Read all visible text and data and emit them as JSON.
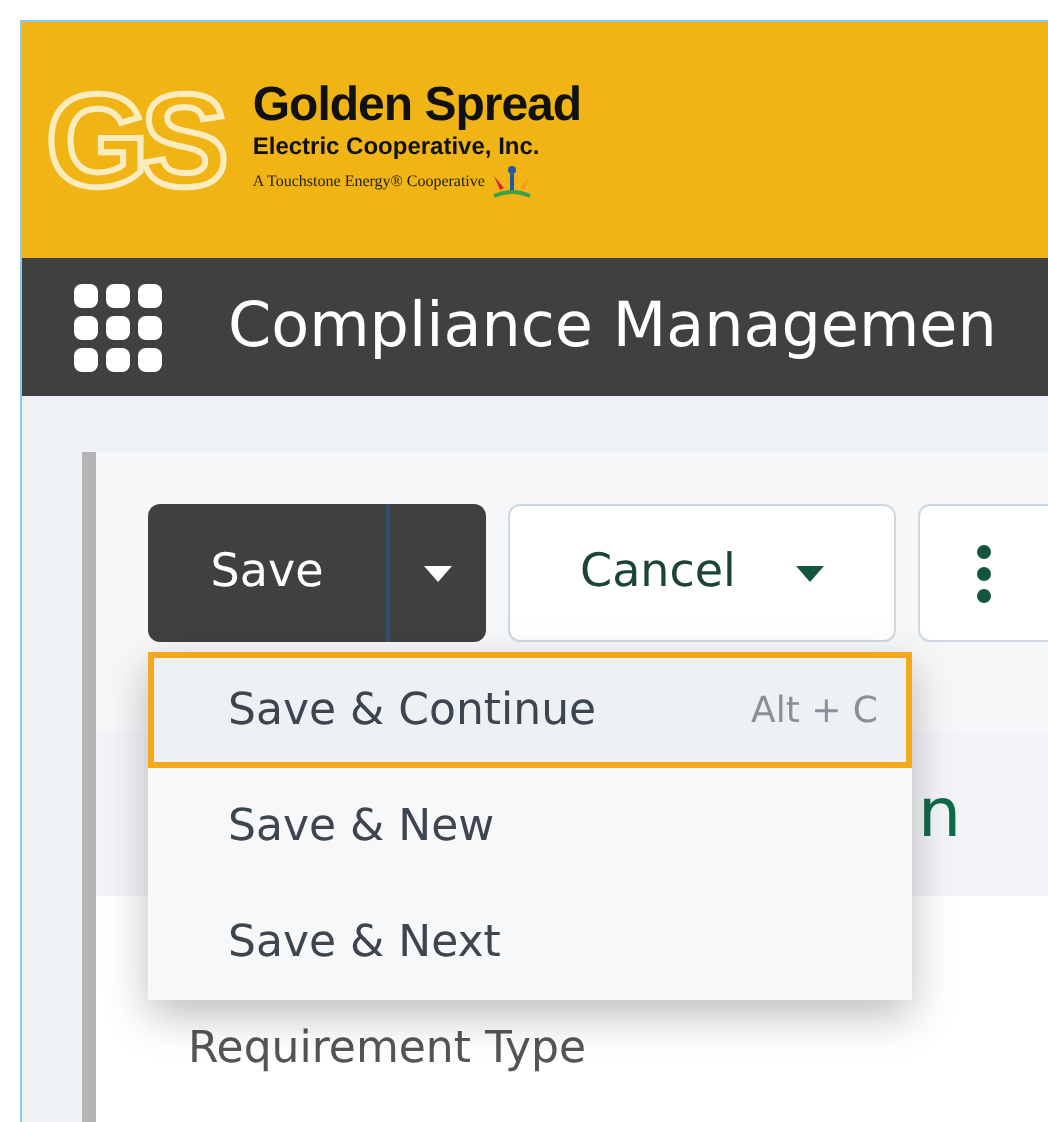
{
  "header": {
    "logo_mark": "GS",
    "company_name": "Golden Spread",
    "company_subtitle": "Electric Cooperative, Inc.",
    "tagline": "A Touchstone Energy® Cooperative"
  },
  "nav": {
    "title": "Compliance Managemen"
  },
  "toolbar": {
    "save_button": "Save",
    "cancel_button": "Cancel"
  },
  "save_menu": [
    {
      "label": "Save & Continue",
      "shortcut": "Alt + C",
      "selected": true
    },
    {
      "label": "Save & New",
      "selected": false
    },
    {
      "label": "Save & Next",
      "selected": false
    }
  ],
  "section_heading": "n",
  "field_label": "Requirement Type"
}
